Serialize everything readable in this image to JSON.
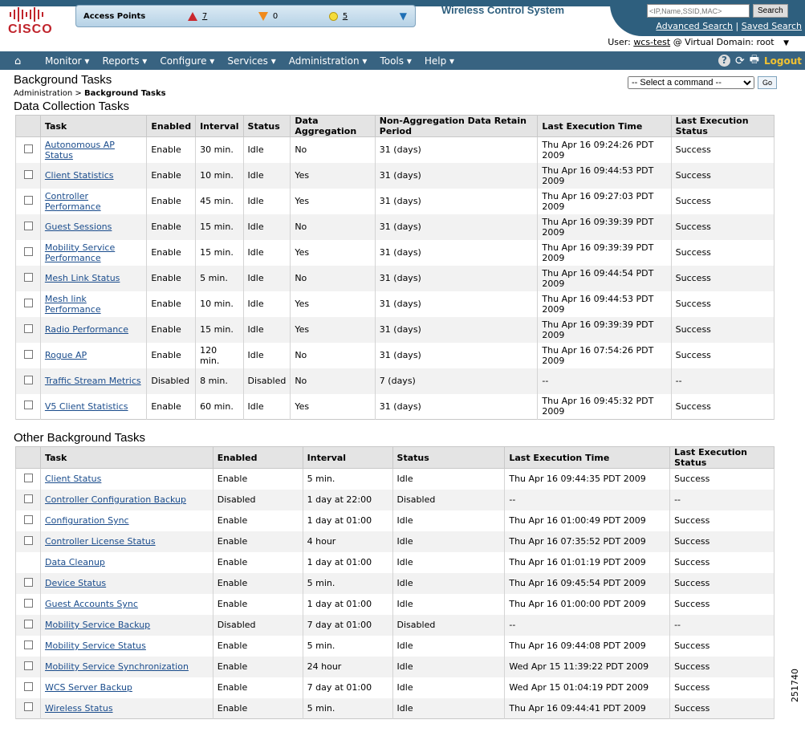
{
  "header": {
    "logo_text": "CISCO",
    "app_title": "Wireless Control System",
    "access_points_label": "Access Points",
    "ap_critical": "7",
    "ap_major": "0",
    "ap_minor": "5",
    "search_placeholder": "<IP,Name,SSID,MAC>",
    "search_button": "Search",
    "advanced_search": "Advanced Search",
    "saved_search": "Saved Search",
    "user_label": "User:",
    "user_name": "wcs-test",
    "domain_label": "@ Virtual Domain:",
    "domain_value": "root"
  },
  "nav": {
    "items": [
      "Monitor ▾",
      "Reports ▾",
      "Configure ▾",
      "Services ▾",
      "Administration ▾",
      "Tools ▾",
      "Help ▾"
    ],
    "logout": "Logout"
  },
  "page": {
    "title": "Background Tasks",
    "breadcrumb_parent": "Administration",
    "breadcrumb_sep": ">",
    "breadcrumb_current": "Background Tasks",
    "command_select": "-- Select a command --",
    "go": "Go"
  },
  "data_collection": {
    "title": "Data Collection Tasks",
    "headers": [
      "Task",
      "Enabled",
      "Interval",
      "Status",
      "Data Aggregation",
      "Non-Aggregation Data Retain Period",
      "Last Execution Time",
      "Last Execution Status"
    ],
    "rows": [
      [
        "Autonomous AP Status",
        "Enable",
        "30 min.",
        "Idle",
        "No",
        "31 (days)",
        "Thu Apr 16 09:24:26 PDT 2009",
        "Success"
      ],
      [
        "Client Statistics",
        "Enable",
        "10 min.",
        "Idle",
        "Yes",
        "31 (days)",
        "Thu Apr 16 09:44:53 PDT 2009",
        "Success"
      ],
      [
        "Controller Performance",
        "Enable",
        "45 min.",
        "Idle",
        "Yes",
        "31 (days)",
        "Thu Apr 16 09:27:03 PDT 2009",
        "Success"
      ],
      [
        "Guest Sessions",
        "Enable",
        "15 min.",
        "Idle",
        "No",
        "31 (days)",
        "Thu Apr 16 09:39:39 PDT 2009",
        "Success"
      ],
      [
        "Mobility Service Performance",
        "Enable",
        "15 min.",
        "Idle",
        "Yes",
        "31 (days)",
        "Thu Apr 16 09:39:39 PDT 2009",
        "Success"
      ],
      [
        "Mesh Link Status",
        "Enable",
        "5 min.",
        "Idle",
        "No",
        "31 (days)",
        "Thu Apr 16 09:44:54 PDT 2009",
        "Success"
      ],
      [
        "Mesh link Performance",
        "Enable",
        "10 min.",
        "Idle",
        "Yes",
        "31 (days)",
        "Thu Apr 16 09:44:53 PDT 2009",
        "Success"
      ],
      [
        "Radio Performance",
        "Enable",
        "15 min.",
        "Idle",
        "Yes",
        "31 (days)",
        "Thu Apr 16 09:39:39 PDT 2009",
        "Success"
      ],
      [
        "Rogue AP",
        "Enable",
        "120 min.",
        "Idle",
        "No",
        "31 (days)",
        "Thu Apr 16 07:54:26 PDT 2009",
        "Success"
      ],
      [
        "Traffic Stream Metrics",
        "Disabled",
        "8 min.",
        "Disabled",
        "No",
        "7 (days)",
        "--",
        "--"
      ],
      [
        "V5 Client Statistics",
        "Enable",
        "60 min.",
        "Idle",
        "Yes",
        "31 (days)",
        "Thu Apr 16 09:45:32 PDT 2009",
        "Success"
      ]
    ]
  },
  "other": {
    "title": "Other Background Tasks",
    "headers": [
      "Task",
      "Enabled",
      "Interval",
      "Status",
      "Last Execution Time",
      "Last Execution Status"
    ],
    "rows": [
      [
        "Client Status",
        "Enable",
        "5 min.",
        "Idle",
        "Thu Apr 16 09:44:35 PDT 2009",
        "Success"
      ],
      [
        "Controller Configuration Backup",
        "Disabled",
        "1 day at 22:00",
        "Disabled",
        "--",
        "--"
      ],
      [
        "Configuration Sync",
        "Enable",
        "1 day at 01:00",
        "Idle",
        "Thu Apr 16 01:00:49 PDT 2009",
        "Success"
      ],
      [
        "Controller License Status",
        "Enable",
        "4 hour",
        "Idle",
        "Thu Apr 16 07:35:52 PDT 2009",
        "Success"
      ],
      [
        "Data Cleanup",
        "Enable",
        "1 day at 01:00",
        "Idle",
        "Thu Apr 16 01:01:19 PDT 2009",
        "Success"
      ],
      [
        "Device Status",
        "Enable",
        "5 min.",
        "Idle",
        "Thu Apr 16 09:45:54 PDT 2009",
        "Success"
      ],
      [
        "Guest Accounts Sync",
        "Enable",
        "1 day at 01:00",
        "Idle",
        "Thu Apr 16 01:00:00 PDT 2009",
        "Success"
      ],
      [
        "Mobility Service Backup",
        "Disabled",
        "7 day at 01:00",
        "Disabled",
        "--",
        "--"
      ],
      [
        "Mobility Service Status",
        "Enable",
        "5 min.",
        "Idle",
        "Thu Apr 16 09:44:08 PDT 2009",
        "Success"
      ],
      [
        "Mobility Service Synchronization",
        "Enable",
        "24 hour",
        "Idle",
        "Wed Apr 15 11:39:22 PDT 2009",
        "Success"
      ],
      [
        "WCS Server Backup",
        "Enable",
        "7 day at 01:00",
        "Idle",
        "Wed Apr 15 01:04:19 PDT 2009",
        "Success"
      ],
      [
        "Wireless Status",
        "Enable",
        "5 min.",
        "Idle",
        "Thu Apr 16 09:44:41 PDT 2009",
        "Success"
      ]
    ],
    "no_checkbox_rows": [
      4
    ]
  },
  "figure_id": "251740"
}
